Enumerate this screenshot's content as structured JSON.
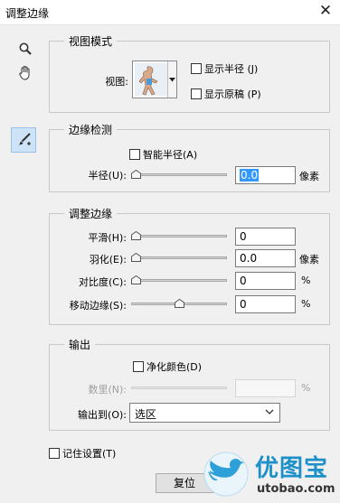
{
  "window": {
    "title": "调整边缘"
  },
  "tools": [
    {
      "name": "zoom",
      "icon": "magnifier-icon"
    },
    {
      "name": "hand",
      "icon": "hand-icon"
    },
    {
      "name": "refine-radius",
      "icon": "refine-brush-icon"
    }
  ],
  "view_mode": {
    "title": "视图模式",
    "view_label": "视图:",
    "show_radius_label": "显示半径 (J)",
    "show_original_label": "显示原稿 (P)",
    "show_radius_checked": false,
    "show_original_checked": false
  },
  "edge_detection": {
    "title": "边缘检测",
    "smart_radius_label": "智能半径(A)",
    "smart_radius_checked": false,
    "radius_label": "半径(U):",
    "radius_value": "0.0",
    "radius_unit": "像素",
    "radius_slider_fraction": 0
  },
  "adjust_edge": {
    "title": "调整边缘",
    "rows": [
      {
        "label": "平滑(H):",
        "value": "0",
        "unit": "",
        "slider_fraction": 0
      },
      {
        "label": "羽化(E):",
        "value": "0.0",
        "unit": "像素",
        "slider_fraction": 0
      },
      {
        "label": "对比度(C):",
        "value": "0",
        "unit": "%",
        "slider_fraction": 0
      },
      {
        "label": "移动边缘(S):",
        "value": "0",
        "unit": "%",
        "slider_fraction": 0.5
      }
    ]
  },
  "output": {
    "title": "输出",
    "decontaminate_label": "净化颜色(D)",
    "decontaminate_checked": false,
    "amount_label": "数里(N):",
    "amount_value": "",
    "amount_unit": "%",
    "amount_slider_fraction": 0,
    "output_to_label": "输出到(O):",
    "output_to_value": "选区"
  },
  "remember_settings_label": "记住设置(T)",
  "remember_settings_checked": false,
  "reset_label": "复位",
  "watermark": {
    "name": "优图宝",
    "url": "utobao.com"
  },
  "colors": {
    "accent_blue": "#3399ff",
    "tool_selected_bg": "#cde3f7",
    "watermark_blue": "#1e90c8"
  }
}
